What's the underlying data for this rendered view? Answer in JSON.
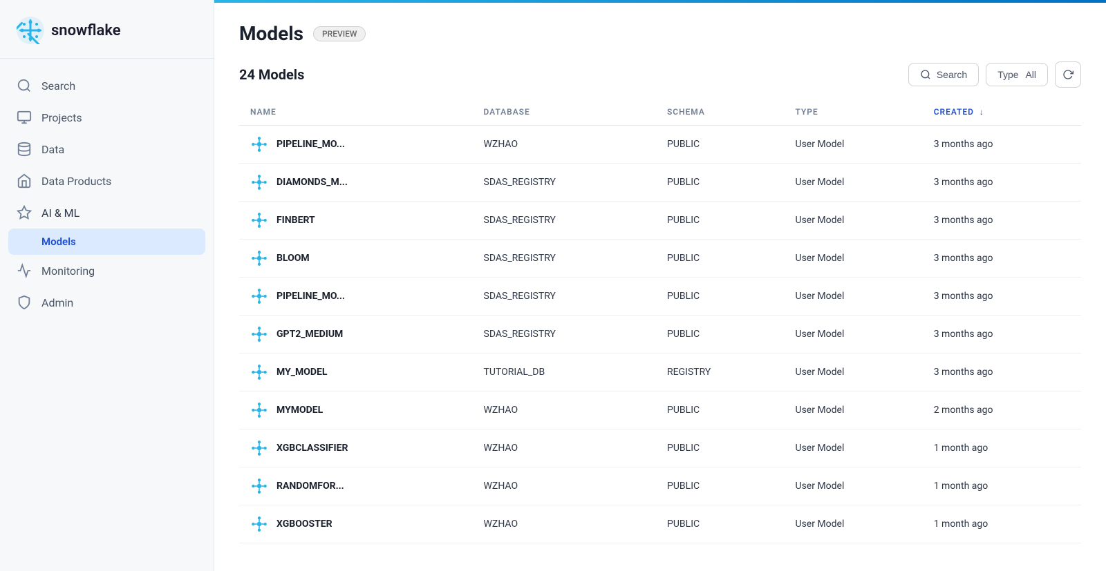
{
  "app": {
    "name": "snowflake",
    "logo_text": "snowflake"
  },
  "sidebar": {
    "items": [
      {
        "id": "search",
        "label": "Search",
        "icon": "search"
      },
      {
        "id": "projects",
        "label": "Projects",
        "icon": "projects"
      },
      {
        "id": "data",
        "label": "Data",
        "icon": "data"
      },
      {
        "id": "data-products",
        "label": "Data Products",
        "icon": "data-products"
      },
      {
        "id": "ai-ml",
        "label": "AI & ML",
        "icon": "ai-ml"
      },
      {
        "id": "monitoring",
        "label": "Monitoring",
        "icon": "monitoring"
      },
      {
        "id": "admin",
        "label": "Admin",
        "icon": "admin"
      }
    ],
    "sub_items": [
      {
        "id": "models",
        "label": "Models",
        "parent": "ai-ml",
        "active": true
      }
    ]
  },
  "page": {
    "title": "Models",
    "badge": "PREVIEW",
    "models_count": "24 Models"
  },
  "toolbar": {
    "search_label": "Search",
    "type_label": "Type",
    "type_value": "All",
    "refresh_label": "Refresh"
  },
  "table": {
    "columns": [
      {
        "id": "name",
        "label": "NAME"
      },
      {
        "id": "database",
        "label": "DATABASE"
      },
      {
        "id": "schema",
        "label": "SCHEMA"
      },
      {
        "id": "type",
        "label": "TYPE"
      },
      {
        "id": "created",
        "label": "CREATED",
        "sorted": true,
        "sort_dir": "desc"
      }
    ],
    "rows": [
      {
        "name": "PIPELINE_MO...",
        "database": "WZHAO",
        "schema": "PUBLIC",
        "type": "User Model",
        "created": "3 months ago"
      },
      {
        "name": "DIAMONDS_M...",
        "database": "SDAS_REGISTRY",
        "schema": "PUBLIC",
        "type": "User Model",
        "created": "3 months ago"
      },
      {
        "name": "FINBERT",
        "database": "SDAS_REGISTRY",
        "schema": "PUBLIC",
        "type": "User Model",
        "created": "3 months ago"
      },
      {
        "name": "BLOOM",
        "database": "SDAS_REGISTRY",
        "schema": "PUBLIC",
        "type": "User Model",
        "created": "3 months ago"
      },
      {
        "name": "PIPELINE_MO...",
        "database": "SDAS_REGISTRY",
        "schema": "PUBLIC",
        "type": "User Model",
        "created": "3 months ago"
      },
      {
        "name": "GPT2_MEDIUM",
        "database": "SDAS_REGISTRY",
        "schema": "PUBLIC",
        "type": "User Model",
        "created": "3 months ago"
      },
      {
        "name": "MY_MODEL",
        "database": "TUTORIAL_DB",
        "schema": "REGISTRY",
        "type": "User Model",
        "created": "3 months ago"
      },
      {
        "name": "MYMODEL",
        "database": "WZHAO",
        "schema": "PUBLIC",
        "type": "User Model",
        "created": "2 months ago"
      },
      {
        "name": "XGBCLASSIFIER",
        "database": "WZHAO",
        "schema": "PUBLIC",
        "type": "User Model",
        "created": "1 month ago"
      },
      {
        "name": "RANDOMFOR...",
        "database": "WZHAO",
        "schema": "PUBLIC",
        "type": "User Model",
        "created": "1 month ago"
      },
      {
        "name": "XGBOOSTER",
        "database": "WZHAO",
        "schema": "PUBLIC",
        "type": "User Model",
        "created": "1 month ago"
      }
    ]
  },
  "colors": {
    "accent": "#29b5e8",
    "brand_blue": "#0072c3",
    "active_nav": "#1d4ed8",
    "active_nav_bg": "#dbeafe"
  }
}
